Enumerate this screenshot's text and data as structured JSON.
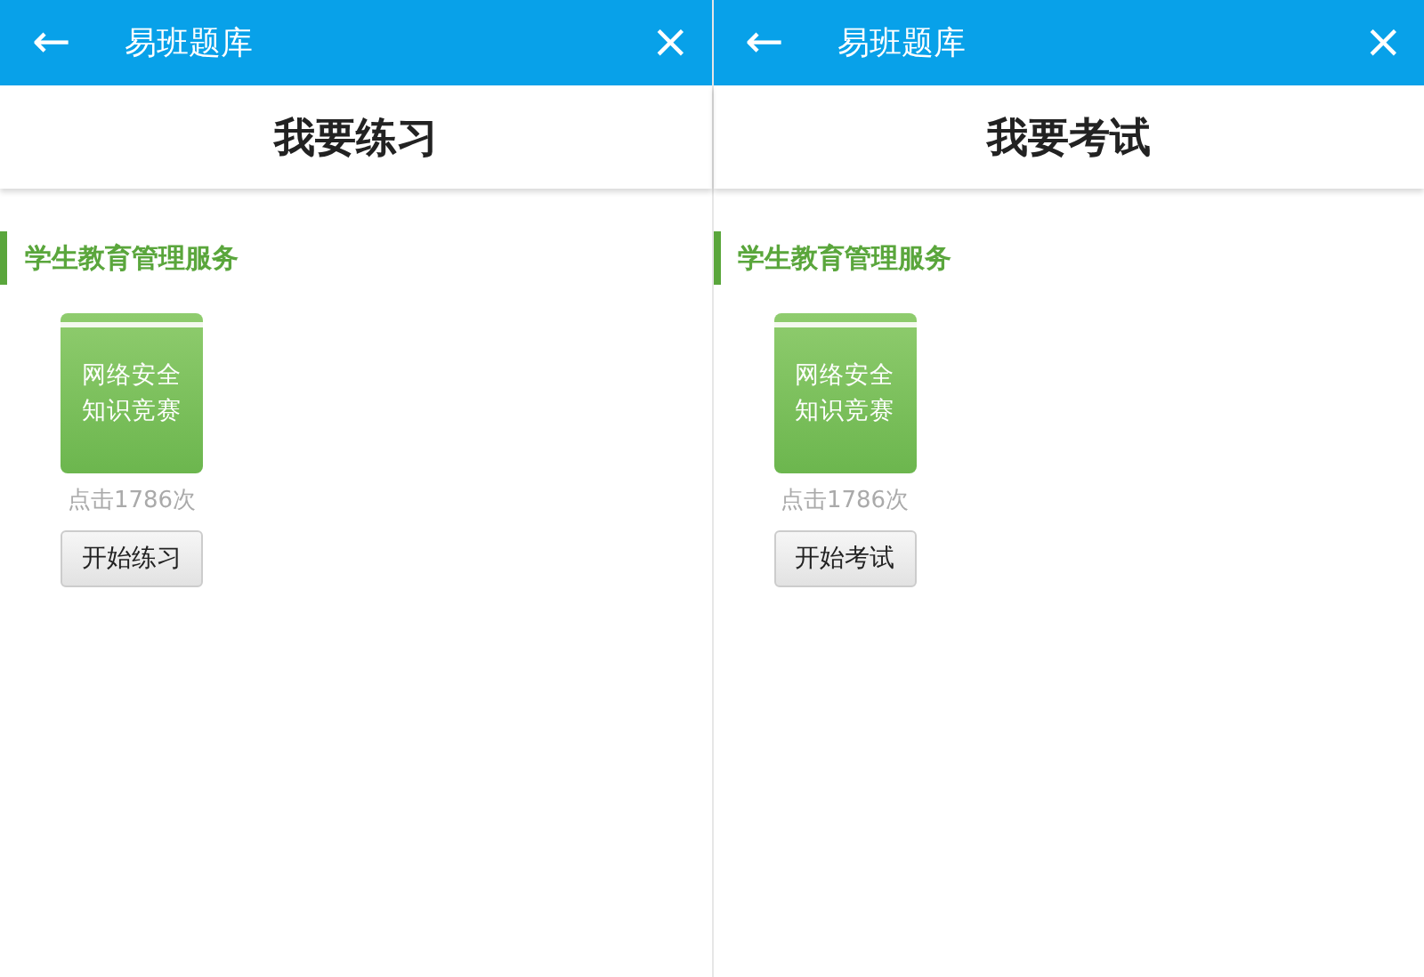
{
  "screens": [
    {
      "app_bar": {
        "back": "←",
        "title": "易班题库",
        "close": "×"
      },
      "heading": "我要练习",
      "section": "学生教育管理服务",
      "items": [
        {
          "cover_title": "网络安全知识竞赛",
          "clicks": "点击1786次",
          "button": "开始练习"
        }
      ]
    },
    {
      "app_bar": {
        "back": "←",
        "title": "易班题库",
        "close": "×"
      },
      "heading": "我要考试",
      "section": "学生教育管理服务",
      "items": [
        {
          "cover_title": "网络安全知识竞赛",
          "clicks": "点击1786次",
          "button": "开始考试"
        }
      ]
    }
  ]
}
